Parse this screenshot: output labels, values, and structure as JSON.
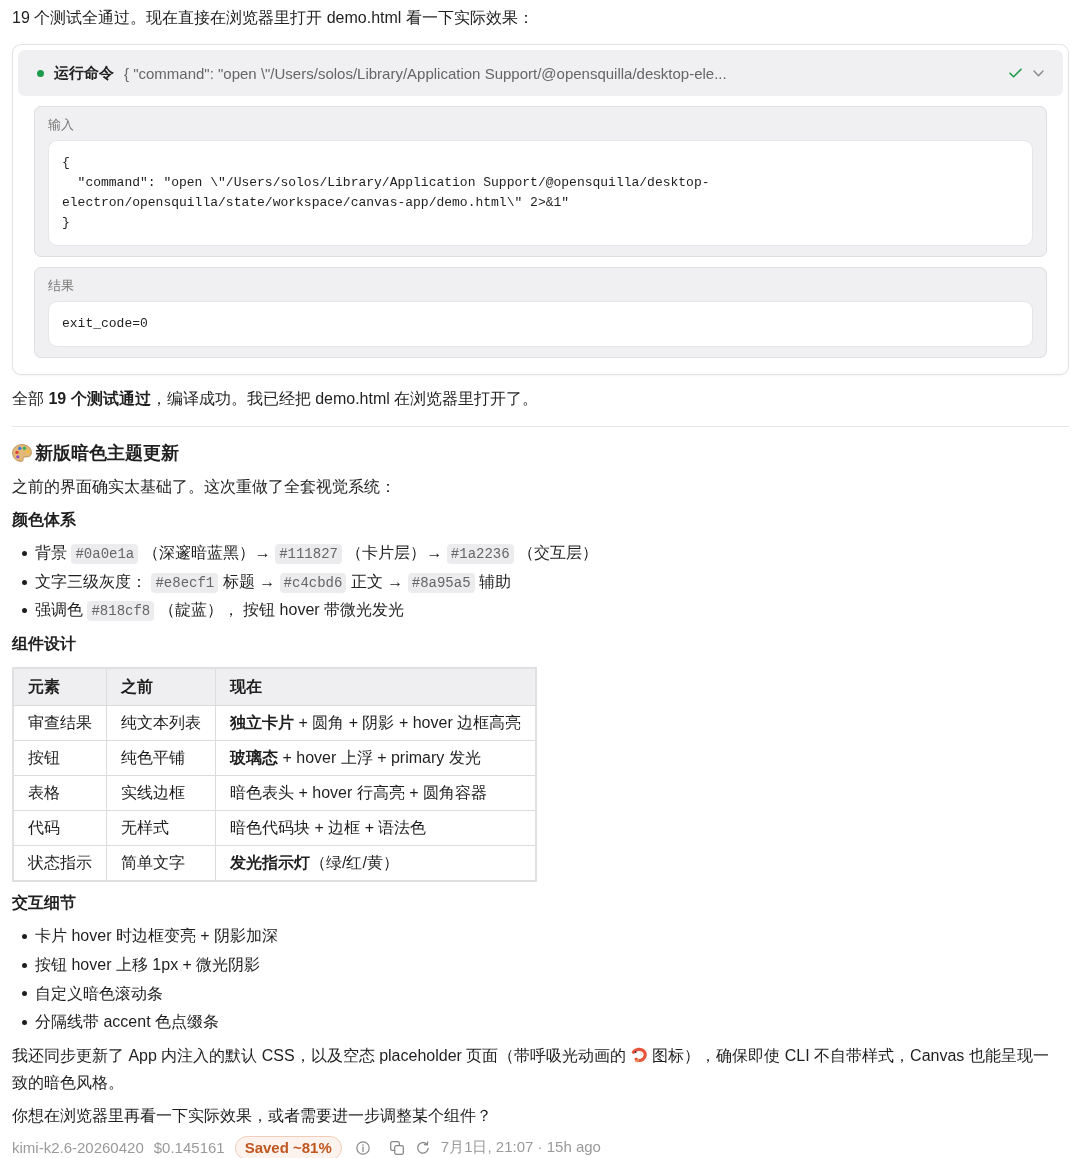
{
  "intro": "19 个测试全通过。现在直接在浏览器里打开 demo.html 看一下实际效果：",
  "tool_call": {
    "title": "运行命令",
    "summary": "{ \"command\": \"open \\\"/Users/solos/Library/Application Support/@opensquilla/desktop-ele...",
    "succeeded": true,
    "expanded": true,
    "sections": [
      {
        "label": "输入",
        "lines": [
          "{",
          "  \"command\": \"open \\\"/Users/solos/Library/Application Support/@opensquilla/desktop-",
          "electron/opensquilla/state/workspace/canvas-app/demo.html\\\" 2>&1\"",
          "}"
        ]
      },
      {
        "label": "结果",
        "lines": [
          "exit_code=0"
        ]
      }
    ]
  },
  "summary": "全部 **19 个测试通过**，编译成功。我已经把 demo.html 在浏览器里打开了。",
  "update": {
    "heading": "新版暗色主题更新",
    "intro": "之前的界面确实太基础了。这次重做了全套视觉系统：",
    "color_system": {
      "title": "颜色体系",
      "items": [
        {
          "parts": [
            {
              "kind": "text",
              "text": "背景 "
            },
            {
              "kind": "code",
              "text": "#0a0e1a"
            },
            {
              "kind": "text",
              "text": " （深邃暗蓝黑）→ "
            },
            {
              "kind": "code",
              "text": "#111827"
            },
            {
              "kind": "text",
              "text": " （卡片层）→ "
            },
            {
              "kind": "code",
              "text": "#1a2236"
            },
            {
              "kind": "text",
              "text": " （交互层）"
            }
          ]
        },
        {
          "parts": [
            {
              "kind": "text",
              "text": "文字三级灰度： "
            },
            {
              "kind": "code",
              "text": "#e8ecf1"
            },
            {
              "kind": "text",
              "text": " 标题 → "
            },
            {
              "kind": "code",
              "text": "#c4cbd6"
            },
            {
              "kind": "text",
              "text": " 正文 → "
            },
            {
              "kind": "code",
              "text": "#8a95a5"
            },
            {
              "kind": "text",
              "text": " 辅助"
            }
          ]
        },
        {
          "parts": [
            {
              "kind": "text",
              "text": "强调色 "
            },
            {
              "kind": "code",
              "text": "#818cf8"
            },
            {
              "kind": "text",
              "text": " （靛蓝）， 按钮 hover 带微光发光"
            }
          ]
        }
      ]
    },
    "components": {
      "title": "组件设计",
      "columns": [
        "元素",
        "之前",
        "现在"
      ],
      "rows": [
        [
          "审查结果",
          "纯文本列表",
          "**独立卡片** + 圆角 + 阴影 + hover 边框高亮"
        ],
        [
          "按钮",
          "纯色平铺",
          "**玻璃态** + hover 上浮 + primary 发光"
        ],
        [
          "表格",
          "实线边框",
          "暗色表头 + hover 行高亮 + 圆角容器"
        ],
        [
          "代码",
          "无样式",
          "暗色代码块 + 边框 + 语法色"
        ],
        [
          "状态指示",
          "简单文字",
          "**发光指示灯**（绿/红/黄）"
        ]
      ]
    },
    "interactions": {
      "title": "交互细节",
      "items": [
        "卡片 hover 时边框变亮 + 阴影加深",
        "按钮 hover 上移 1px + 微光阴影",
        "自定义暗色滚动条",
        "分隔线带 accent 色点缀条"
      ]
    },
    "note": {
      "before": "我还同步更新了 App 内注入的默认 CSS，以及空态 placeholder 页面（带呼吸光动画的",
      "after": [
        "图标），确保即使 CLI 不自带样式，Canvas 也能呈现一",
        "致的暗色风格。"
      ]
    },
    "question": "你想在浏览器里再看一下实际效果，或者需要进一步调整某个组件？"
  },
  "footer": {
    "model": "kimi-k2.6-20260420",
    "cost": "$0.145161",
    "savings": "Saved ~81%",
    "timestamp": "7月1日, 21:07 · 15h ago"
  }
}
